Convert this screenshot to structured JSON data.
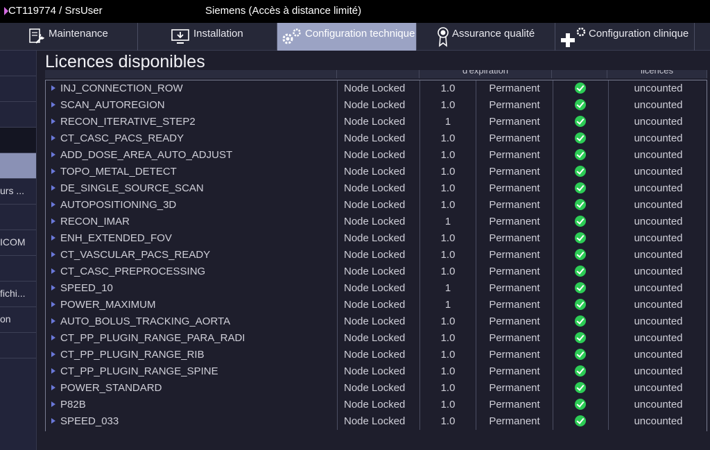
{
  "titlebar": {
    "user": "CT119774 / SrsUser",
    "remote_status": "Siemens (Accès à distance limité)"
  },
  "tabs": [
    {
      "label": "Maintenance",
      "icon": "wrench-document-icon",
      "active": false
    },
    {
      "label": "Installation",
      "icon": "monitor-download-icon",
      "active": false
    },
    {
      "label": "Configuration technique",
      "icon": "gears-icon",
      "active": true
    },
    {
      "label": "Assurance qualité",
      "icon": "award-ribbon-icon",
      "active": false
    },
    {
      "label": "Configuration clinique",
      "icon": "plus-gear-icon",
      "active": false
    }
  ],
  "sidebar": {
    "items": [
      {
        "label": ""
      },
      {
        "label": ""
      },
      {
        "label": ""
      },
      {
        "label": ""
      },
      {
        "label": ""
      },
      {
        "label": "urs ..."
      },
      {
        "label": ""
      },
      {
        "label": "ICOM"
      },
      {
        "label": ""
      },
      {
        "label": "fichi..."
      },
      {
        "label": "on"
      },
      {
        "label": ""
      }
    ]
  },
  "main": {
    "title": "Licences disponibles",
    "headers": {
      "expiration": "d'expiration",
      "licenses": "licences"
    }
  },
  "colors": {
    "active_tab": "#9ba3c4",
    "check_green": "#2ccc55",
    "expand_arrow": "#6a78d8"
  },
  "licenses": [
    {
      "name": "INJ_CONNECTION_ROW",
      "type": "Node Locked",
      "version": "1.0",
      "expiration": "Permanent",
      "valid": true,
      "count": "uncounted"
    },
    {
      "name": "SCAN_AUTOREGION",
      "type": "Node Locked",
      "version": "1.0",
      "expiration": "Permanent",
      "valid": true,
      "count": "uncounted"
    },
    {
      "name": "RECON_ITERATIVE_STEP2",
      "type": "Node Locked",
      "version": "1",
      "expiration": "Permanent",
      "valid": true,
      "count": "uncounted"
    },
    {
      "name": "CT_CASC_PACS_READY",
      "type": "Node Locked",
      "version": "1.0",
      "expiration": "Permanent",
      "valid": true,
      "count": "uncounted"
    },
    {
      "name": "ADD_DOSE_AREA_AUTO_ADJUST",
      "type": "Node Locked",
      "version": "1.0",
      "expiration": "Permanent",
      "valid": true,
      "count": "uncounted"
    },
    {
      "name": "TOPO_METAL_DETECT",
      "type": "Node Locked",
      "version": "1.0",
      "expiration": "Permanent",
      "valid": true,
      "count": "uncounted"
    },
    {
      "name": "DE_SINGLE_SOURCE_SCAN",
      "type": "Node Locked",
      "version": "1.0",
      "expiration": "Permanent",
      "valid": true,
      "count": "uncounted"
    },
    {
      "name": "AUTOPOSITIONING_3D",
      "type": "Node Locked",
      "version": "1.0",
      "expiration": "Permanent",
      "valid": true,
      "count": "uncounted"
    },
    {
      "name": "RECON_IMAR",
      "type": "Node Locked",
      "version": "1",
      "expiration": "Permanent",
      "valid": true,
      "count": "uncounted"
    },
    {
      "name": "ENH_EXTENDED_FOV",
      "type": "Node Locked",
      "version": "1.0",
      "expiration": "Permanent",
      "valid": true,
      "count": "uncounted"
    },
    {
      "name": "CT_VASCULAR_PACS_READY",
      "type": "Node Locked",
      "version": "1.0",
      "expiration": "Permanent",
      "valid": true,
      "count": "uncounted"
    },
    {
      "name": "CT_CASC_PREPROCESSING",
      "type": "Node Locked",
      "version": "1.0",
      "expiration": "Permanent",
      "valid": true,
      "count": "uncounted"
    },
    {
      "name": "SPEED_10",
      "type": "Node Locked",
      "version": "1",
      "expiration": "Permanent",
      "valid": true,
      "count": "uncounted"
    },
    {
      "name": "POWER_MAXIMUM",
      "type": "Node Locked",
      "version": "1",
      "expiration": "Permanent",
      "valid": true,
      "count": "uncounted"
    },
    {
      "name": "AUTO_BOLUS_TRACKING_AORTA",
      "type": "Node Locked",
      "version": "1.0",
      "expiration": "Permanent",
      "valid": true,
      "count": "uncounted"
    },
    {
      "name": "CT_PP_PLUGIN_RANGE_PARA_RADI",
      "type": "Node Locked",
      "version": "1.0",
      "expiration": "Permanent",
      "valid": true,
      "count": "uncounted"
    },
    {
      "name": "CT_PP_PLUGIN_RANGE_RIB",
      "type": "Node Locked",
      "version": "1.0",
      "expiration": "Permanent",
      "valid": true,
      "count": "uncounted"
    },
    {
      "name": "CT_PP_PLUGIN_RANGE_SPINE",
      "type": "Node Locked",
      "version": "1.0",
      "expiration": "Permanent",
      "valid": true,
      "count": "uncounted"
    },
    {
      "name": "POWER_STANDARD",
      "type": "Node Locked",
      "version": "1.0",
      "expiration": "Permanent",
      "valid": true,
      "count": "uncounted"
    },
    {
      "name": "P82B",
      "type": "Node Locked",
      "version": "1.0",
      "expiration": "Permanent",
      "valid": true,
      "count": "uncounted"
    },
    {
      "name": "SPEED_033",
      "type": "Node Locked",
      "version": "1.0",
      "expiration": "Permanent",
      "valid": true,
      "count": "uncounted"
    }
  ]
}
